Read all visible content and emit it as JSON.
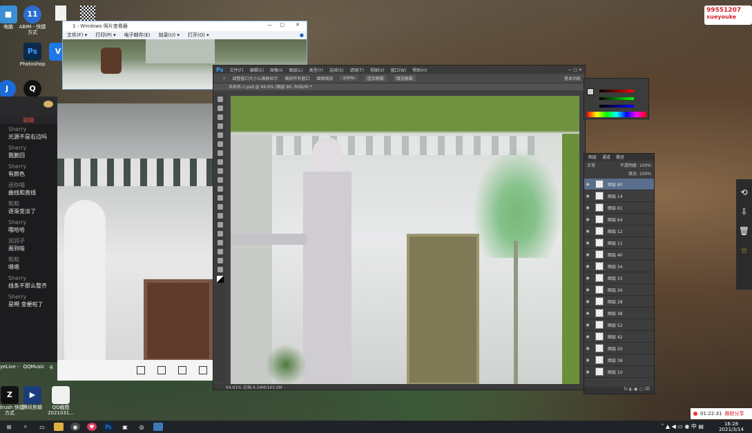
{
  "desktop_icons": [
    {
      "label": "电脑",
      "glyph": "■",
      "color": "#3a8fd6"
    },
    {
      "label": "ABIM - 快捷方式",
      "glyph": "11",
      "color": "#2b6cd0"
    },
    {
      "label": "Photoshop",
      "glyph": "Ps",
      "color": "#0b2a4a"
    },
    {
      "label": "",
      "glyph": "V",
      "color": "#1f78e6"
    },
    {
      "label": "",
      "glyph": "Q",
      "color": "#111"
    },
    {
      "label": "",
      "glyph": "J",
      "color": "#1a6bd8"
    }
  ],
  "photo_viewer": {
    "title": "1 - Windows 照片查看器",
    "menu": [
      "文件(F) ▾",
      "打印(P) ▾",
      "电子邮件(E)",
      "刻录(U) ▾",
      "打开(O) ▾"
    ]
  },
  "chat": {
    "tab": "聊聊",
    "messages": [
      {
        "user": "Sherry",
        "text": "光源不是右边吗"
      },
      {
        "user": "Sherry",
        "text": "我脆回"
      },
      {
        "user": "Sherry",
        "text": "有颜色"
      },
      {
        "user": "送你喵",
        "text": "曲线和直线"
      },
      {
        "user": "和和",
        "text": "逐渐变淡了"
      },
      {
        "user": "Sherry",
        "text": "哦哈哈"
      },
      {
        "user": "润润子",
        "text": "画到啥"
      },
      {
        "user": "和和",
        "text": "嗯嗯"
      },
      {
        "user": "Sherry",
        "text": "线条不那么整齐"
      },
      {
        "user": "Sherry",
        "text": "是啊 变梗啦了"
      }
    ]
  },
  "photoshop": {
    "logo": "Ps",
    "menus": [
      "文件(F)",
      "编辑(E)",
      "图像(I)",
      "图层(L)",
      "类型(Y)",
      "选择(S)",
      "滤镜(T)",
      "视图(V)",
      "窗口(W)",
      "帮助(H)"
    ],
    "options": [
      "调整窗口大小以满屏显示",
      "缩放所有窗口",
      "细微缩放",
      "100%",
      "适合屏幕",
      "填充屏幕",
      "基本功能"
    ],
    "doc_tab": "未命名-1.psd @ 94.6% (图层 80, RGB/8) *",
    "status": "94.61%    文档:4.34M/143.0M"
  },
  "layers_panel": {
    "tabs": [
      "图层",
      "通道",
      "路径"
    ],
    "blend": "正常",
    "opacity": "不透明度: 100%",
    "fill": "填充: 100%",
    "items": [
      "图层 80",
      "图层 14",
      "图层 61",
      "图层 64",
      "图层 12",
      "图层 11",
      "图层 40",
      "图层 34",
      "图层 33",
      "图层 26",
      "图层 28",
      "图层 38",
      "图层 52",
      "图层 42",
      "图层 20",
      "图层 38",
      "图层 10"
    ]
  },
  "live_badge": {
    "id": "99551207",
    "name": "xueyouke"
  },
  "recording": {
    "time": "01:22:31",
    "label": "跟踪分享"
  },
  "clock": {
    "time": "16:28",
    "date": "2021/3/14"
  },
  "bottom_icons": [
    {
      "label": "ZBrush 快捷方式"
    },
    {
      "label": "腾讯剪辑"
    },
    {
      "label": "QQ截图 2021031..."
    }
  ],
  "taskbar_labels": [
    "yeLive -",
    "QQMusic",
    "卡"
  ]
}
